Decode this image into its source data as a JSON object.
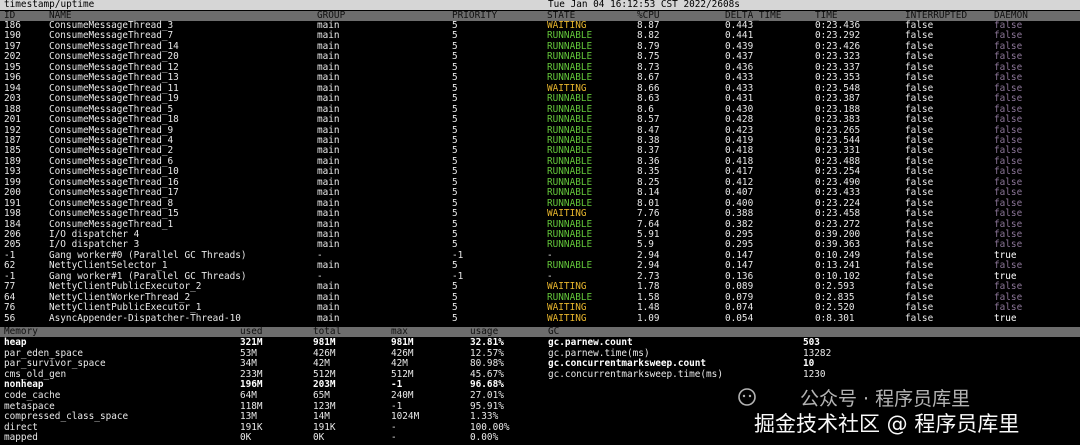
{
  "status_bar": {
    "left": "timestamp/uptime",
    "right": "Tue Jan 04 16:12:53 CST 2022/2608s"
  },
  "thread_columns": [
    "ID",
    "NAME",
    "GROUP",
    "PRIORITY",
    "STATE",
    "%CPU",
    "DELTA_TIME",
    "TIME",
    "INTERRUPTED",
    "DAEMON"
  ],
  "threads": [
    [
      "186",
      "ConsumeMessageThread_3",
      "main",
      "5",
      "WAITING",
      "8.87",
      "0.443",
      "0:23.436",
      "false",
      "false"
    ],
    [
      "190",
      "ConsumeMessageThread_7",
      "main",
      "5",
      "RUNNABLE",
      "8.82",
      "0.441",
      "0:23.292",
      "false",
      "false"
    ],
    [
      "197",
      "ConsumeMessageThread_14",
      "main",
      "5",
      "RUNNABLE",
      "8.79",
      "0.439",
      "0:23.426",
      "false",
      "false"
    ],
    [
      "202",
      "ConsumeMessageThread_20",
      "main",
      "5",
      "RUNNABLE",
      "8.75",
      "0.437",
      "0:23.323",
      "false",
      "false"
    ],
    [
      "195",
      "ConsumeMessageThread_12",
      "main",
      "5",
      "RUNNABLE",
      "8.73",
      "0.436",
      "0:23.337",
      "false",
      "false"
    ],
    [
      "196",
      "ConsumeMessageThread_13",
      "main",
      "5",
      "RUNNABLE",
      "8.67",
      "0.433",
      "0:23.353",
      "false",
      "false"
    ],
    [
      "194",
      "ConsumeMessageThread_11",
      "main",
      "5",
      "WAITING",
      "8.66",
      "0.433",
      "0:23.548",
      "false",
      "false"
    ],
    [
      "203",
      "ConsumeMessageThread_19",
      "main",
      "5",
      "RUNNABLE",
      "8.63",
      "0.431",
      "0:23.387",
      "false",
      "false"
    ],
    [
      "188",
      "ConsumeMessageThread_5",
      "main",
      "5",
      "RUNNABLE",
      "8.6",
      "0.430",
      "0:23.188",
      "false",
      "false"
    ],
    [
      "201",
      "ConsumeMessageThread_18",
      "main",
      "5",
      "RUNNABLE",
      "8.57",
      "0.428",
      "0:23.383",
      "false",
      "false"
    ],
    [
      "192",
      "ConsumeMessageThread_9",
      "main",
      "5",
      "RUNNABLE",
      "8.47",
      "0.423",
      "0:23.265",
      "false",
      "false"
    ],
    [
      "187",
      "ConsumeMessageThread_4",
      "main",
      "5",
      "RUNNABLE",
      "8.38",
      "0.419",
      "0:23.544",
      "false",
      "false"
    ],
    [
      "185",
      "ConsumeMessageThread_2",
      "main",
      "5",
      "RUNNABLE",
      "8.37",
      "0.418",
      "0:23.331",
      "false",
      "false"
    ],
    [
      "189",
      "ConsumeMessageThread_6",
      "main",
      "5",
      "RUNNABLE",
      "8.36",
      "0.418",
      "0:23.488",
      "false",
      "false"
    ],
    [
      "193",
      "ConsumeMessageThread_10",
      "main",
      "5",
      "RUNNABLE",
      "8.35",
      "0.417",
      "0:23.254",
      "false",
      "false"
    ],
    [
      "199",
      "ConsumeMessageThread_16",
      "main",
      "5",
      "RUNNABLE",
      "8.25",
      "0.412",
      "0:23.490",
      "false",
      "false"
    ],
    [
      "200",
      "ConsumeMessageThread_17",
      "main",
      "5",
      "RUNNABLE",
      "8.14",
      "0.407",
      "0:23.433",
      "false",
      "false"
    ],
    [
      "191",
      "ConsumeMessageThread_8",
      "main",
      "5",
      "RUNNABLE",
      "8.01",
      "0.400",
      "0:23.224",
      "false",
      "false"
    ],
    [
      "198",
      "ConsumeMessageThread_15",
      "main",
      "5",
      "WAITING",
      "7.76",
      "0.388",
      "0:23.458",
      "false",
      "false"
    ],
    [
      "184",
      "ConsumeMessageThread_1",
      "main",
      "5",
      "RUNNABLE",
      "7.64",
      "0.382",
      "0:23.272",
      "false",
      "false"
    ],
    [
      "206",
      "I/O dispatcher 4",
      "main",
      "5",
      "RUNNABLE",
      "5.91",
      "0.295",
      "0:39.200",
      "false",
      "false"
    ],
    [
      "205",
      "I/O dispatcher 3",
      "main",
      "5",
      "RUNNABLE",
      "5.9",
      "0.295",
      "0:39.363",
      "false",
      "false"
    ],
    [
      "-1",
      "Gang worker#0 (Parallel GC Threads)",
      "-",
      "-1",
      "-",
      "2.94",
      "0.147",
      "0:10.249",
      "false",
      "true"
    ],
    [
      "62",
      "NettyClientSelector_1",
      "main",
      "5",
      "RUNNABLE",
      "2.94",
      "0.147",
      "0:13.241",
      "false",
      "false"
    ],
    [
      "-1",
      "Gang worker#1 (Parallel GC Threads)",
      "-",
      "-1",
      "-",
      "2.73",
      "0.136",
      "0:10.102",
      "false",
      "true"
    ],
    [
      "77",
      "NettyClientPublicExecutor_2",
      "main",
      "5",
      "WAITING",
      "1.78",
      "0.089",
      "0:2.593",
      "false",
      "false"
    ],
    [
      "64",
      "NettyClientWorkerThread_2",
      "main",
      "5",
      "RUNNABLE",
      "1.58",
      "0.079",
      "0:2.835",
      "false",
      "false"
    ],
    [
      "76",
      "NettyClientPublicExecutor_1",
      "main",
      "5",
      "WAITING",
      "1.48",
      "0.074",
      "0:2.520",
      "false",
      "false"
    ],
    [
      "56",
      "AsyncAppender-Dispatcher-Thread-10",
      "main",
      "5",
      "WAITING",
      "1.09",
      "0.054",
      "0:8.301",
      "false",
      "true"
    ]
  ],
  "memory_columns": [
    "Memory",
    "used",
    "total",
    "max",
    "usage"
  ],
  "memory": [
    [
      "heap",
      "321M",
      "981M",
      "981M",
      "32.81%"
    ],
    [
      "par_eden_space",
      "53M",
      "426M",
      "426M",
      "12.57%"
    ],
    [
      "par_survivor_space",
      "34M",
      "42M",
      "42M",
      "80.98%"
    ],
    [
      "cms_old_gen",
      "233M",
      "512M",
      "512M",
      "45.67%"
    ],
    [
      "nonheap",
      "196M",
      "203M",
      "-1",
      "96.68%"
    ],
    [
      "code_cache",
      "64M",
      "65M",
      "240M",
      "27.01%"
    ],
    [
      "metaspace",
      "118M",
      "123M",
      "-1",
      "95.91%"
    ],
    [
      "compressed_class_space",
      "13M",
      "14M",
      "1024M",
      "1.33%"
    ],
    [
      "direct",
      "191K",
      "191K",
      "-",
      "100.00%"
    ],
    [
      "mapped",
      "0K",
      "0K",
      "-",
      "0.00%"
    ]
  ],
  "gc_header": "GC",
  "gc": [
    [
      "gc.parnew.count",
      "503"
    ],
    [
      "gc.parnew.time(ms)",
      "13282"
    ],
    [
      "gc.concurrentmarksweep.count",
      "10"
    ],
    [
      "gc.concurrentmarksweep.time(ms)",
      "1230"
    ]
  ],
  "watermark": {
    "line1": "公众号 · 程序员库里",
    "line2": "掘金技术社区 @ 程序员库里"
  },
  "colors": {
    "runnable": "#63c63a",
    "waiting": "#e7b52c",
    "daemon_false": "#8b7597"
  }
}
